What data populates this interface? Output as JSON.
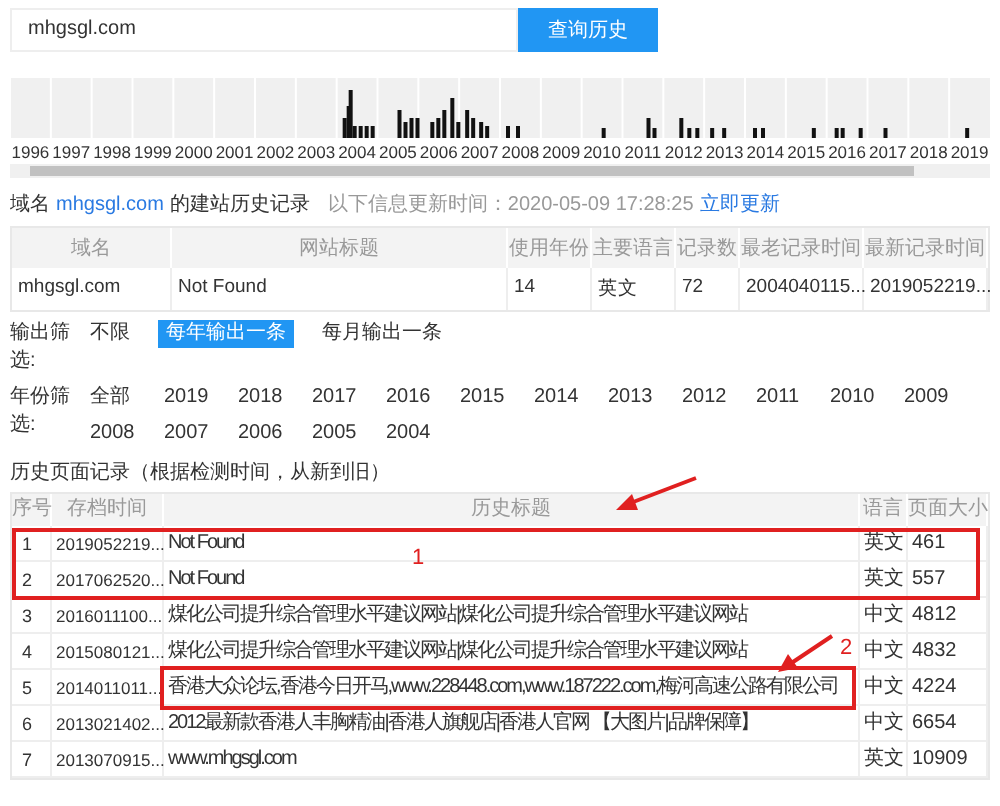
{
  "search": {
    "value": "mhgsgl.com",
    "button": "查询历史"
  },
  "timeline": {
    "years": [
      "1996",
      "1997",
      "1998",
      "1999",
      "2000",
      "2001",
      "2002",
      "2003",
      "2004",
      "2005",
      "2006",
      "2007",
      "2008",
      "2009",
      "2010",
      "2011",
      "2012",
      "2013",
      "2014",
      "2015",
      "2016",
      "2017",
      "2018",
      "2019"
    ]
  },
  "info": {
    "prefix": "域名",
    "domain": "mhgsgl.com",
    "suffix": "的建站历史记录",
    "updated": "以下信息更新时间：2020-05-09 17:28:25",
    "update_link": "立即更新"
  },
  "summary": {
    "columns": [
      "域名",
      "网站标题",
      "使用年份",
      "主要语言",
      "记录数",
      "最老记录时间",
      "最新记录时间"
    ],
    "row": [
      "mhgsgl.com",
      "Not Found",
      "14",
      "英文",
      "72",
      "2004040115...",
      "2019052219..."
    ]
  },
  "output_filter": {
    "label": "输出筛选:",
    "options": [
      {
        "label": "不限",
        "selected": false
      },
      {
        "label": "每年输出一条",
        "selected": true
      },
      {
        "label": "每月输出一条",
        "selected": false
      }
    ]
  },
  "year_filter": {
    "label": "年份筛选:",
    "options": [
      {
        "label": "全部",
        "selected": false
      },
      {
        "label": "2019",
        "selected": false
      },
      {
        "label": "2018",
        "selected": false
      },
      {
        "label": "2017",
        "selected": false
      },
      {
        "label": "2016",
        "selected": false
      },
      {
        "label": "2015",
        "selected": false
      },
      {
        "label": "2014",
        "selected": false
      },
      {
        "label": "2013",
        "selected": false
      },
      {
        "label": "2012",
        "selected": false
      },
      {
        "label": "2011",
        "selected": false
      },
      {
        "label": "2010",
        "selected": false
      },
      {
        "label": "2009",
        "selected": false
      },
      {
        "label": "2008",
        "selected": false
      },
      {
        "label": "2007",
        "selected": false
      },
      {
        "label": "2006",
        "selected": false
      },
      {
        "label": "2005",
        "selected": false
      },
      {
        "label": "2004",
        "selected": false
      }
    ]
  },
  "history": {
    "title": "历史页面记录（根据检测时间，从新到旧）",
    "columns": [
      "序号",
      "存档时间",
      "历史标题",
      "语言",
      "页面大小"
    ],
    "rows": [
      [
        "1",
        "2019052219...",
        "Not Found",
        "英文",
        "461"
      ],
      [
        "2",
        "2017062520...",
        "Not Found",
        "英文",
        "557"
      ],
      [
        "3",
        "2016011100...",
        "煤化公司提升综合管理水平建议网站|煤化公司提升综合管理水平建议网站",
        "中文",
        "4812"
      ],
      [
        "4",
        "2015080121...",
        "煤化公司提升综合管理水平建议网站|煤化公司提升综合管理水平建议网站",
        "中文",
        "4832"
      ],
      [
        "5",
        "2014011011...",
        "香港大众论坛,香港今日开马,www.228448.com,www.187222.com,梅河高速公路有限公司",
        "中文",
        "4224"
      ],
      [
        "6",
        "2013021402...",
        "2012最新款香港人丰胸精油|香港人旗舰店|香港人官网 【大图片|品牌保障】",
        "中文",
        "6654"
      ],
      [
        "7",
        "2013070915...",
        "www.mhgsgl.com",
        "英文",
        "10909"
      ]
    ]
  },
  "annotations": [
    "1",
    "2"
  ]
}
